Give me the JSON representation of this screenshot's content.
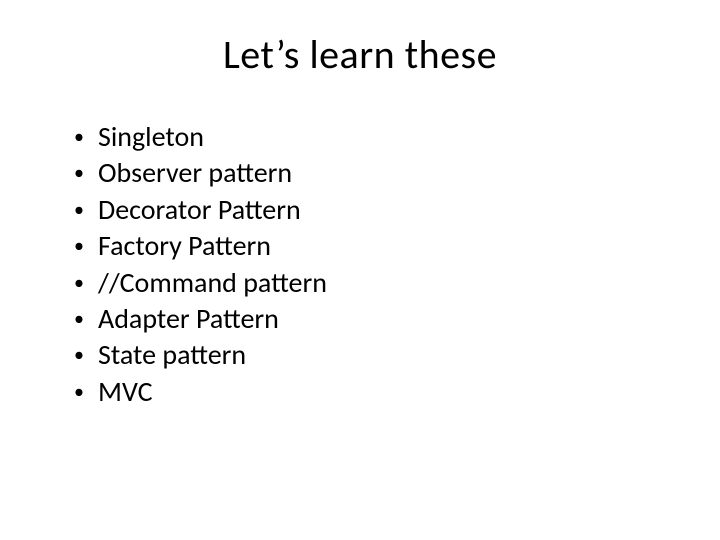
{
  "slide": {
    "title": "Let’s learn these",
    "items": [
      "Singleton",
      "Observer pattern",
      "Decorator Pattern",
      "Factory Pattern",
      "//Command pattern",
      "Adapter Pattern",
      "State pattern",
      "MVC"
    ]
  }
}
